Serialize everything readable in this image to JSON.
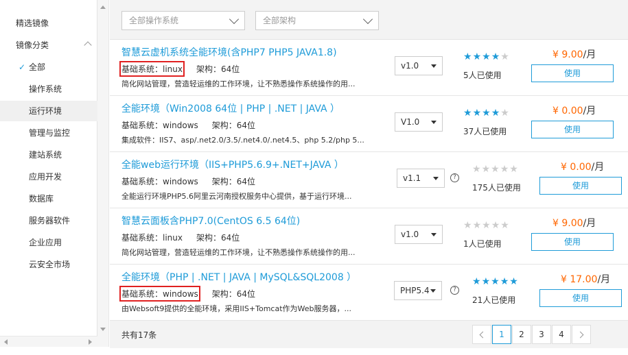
{
  "sidebar": {
    "featured": "精选镜像",
    "categories": "镜像分类",
    "all": "全部",
    "items": [
      "操作系统",
      "运行环境",
      "管理与监控",
      "建站系统",
      "应用开发",
      "数据库",
      "服务器软件",
      "企业应用",
      "云安全市场"
    ],
    "active": "运行环境"
  },
  "filters": {
    "os": "全部操作系统",
    "arch": "全部架构"
  },
  "products": [
    {
      "title": "智慧云虚机系统全能环境(含PHP7 PHP5 JAVA1.8)",
      "os": "基础系统：linux",
      "arch": "架构：64位",
      "desc": "简化网站管理，营造轻运维的工作环境，让不熟悉操作系统操作的用...",
      "version": "v1.0",
      "rating": 3.5,
      "stars_filled": 4,
      "users": "5人已使用",
      "price": "¥ 9.00",
      "unit": "/月",
      "use": "使用"
    },
    {
      "title": "全能环境（Win2008 64位 | PHP | .NET | JAVA ）",
      "os": "基础系统：windows",
      "arch": "架构：64位",
      "desc": "集成软件：IIS7、asp/.net2.0/3.5/.net4.0/.net4.5、php 5.2/php 5...",
      "version": "V1.0",
      "rating": 4,
      "stars_filled": 4,
      "users": "37人已使用",
      "price": "¥ 0.00",
      "unit": "/月",
      "use": "使用"
    },
    {
      "title": "全能web运行环境（IIS+PHP5.6.9+.NET+JAVA ）",
      "os": "基础系统：windows",
      "arch": "架构：64位",
      "desc": "全能运行环境PHP5.6阿里云河南授权服务中心提供，基于运行环境...",
      "version": "v1.1",
      "rating": 0,
      "stars_filled": 0,
      "users": "175人已使用",
      "price": "¥ 0.00",
      "unit": "/月",
      "use": "使用"
    },
    {
      "title": "智慧云面板含PHP7.0(CentOS 6.5 64位)",
      "os": "基础系统：linux",
      "arch": "架构：64位",
      "desc": "简化网站管理，营造轻运维的工作环境，让不熟悉操作系统操作的用...",
      "version": "v1.0",
      "rating": 0,
      "stars_filled": 0,
      "users": "1人已使用",
      "price": "¥ 9.00",
      "unit": "/月",
      "use": "使用"
    },
    {
      "title": "全能环境（PHP | .NET | JAVA | MySQL&SQL2008 ）",
      "os": "基础系统：windows",
      "arch": "架构：64位",
      "desc": "由Websoft9提供的全能环境，采用IIS+Tomcat作为Web服务器，...",
      "version": "PHP5.4",
      "rating": 5,
      "stars_filled": 5,
      "users": "21人已使用",
      "price": "¥ 17.00",
      "unit": "/月",
      "use": "使用"
    }
  ],
  "pagination": {
    "total": "共有17条",
    "pages": [
      "1",
      "2",
      "3",
      "4"
    ],
    "current": "1"
  },
  "colors": {
    "accent": "#1e9bd8",
    "price": "#ff6600",
    "highlight": "#e02020"
  }
}
